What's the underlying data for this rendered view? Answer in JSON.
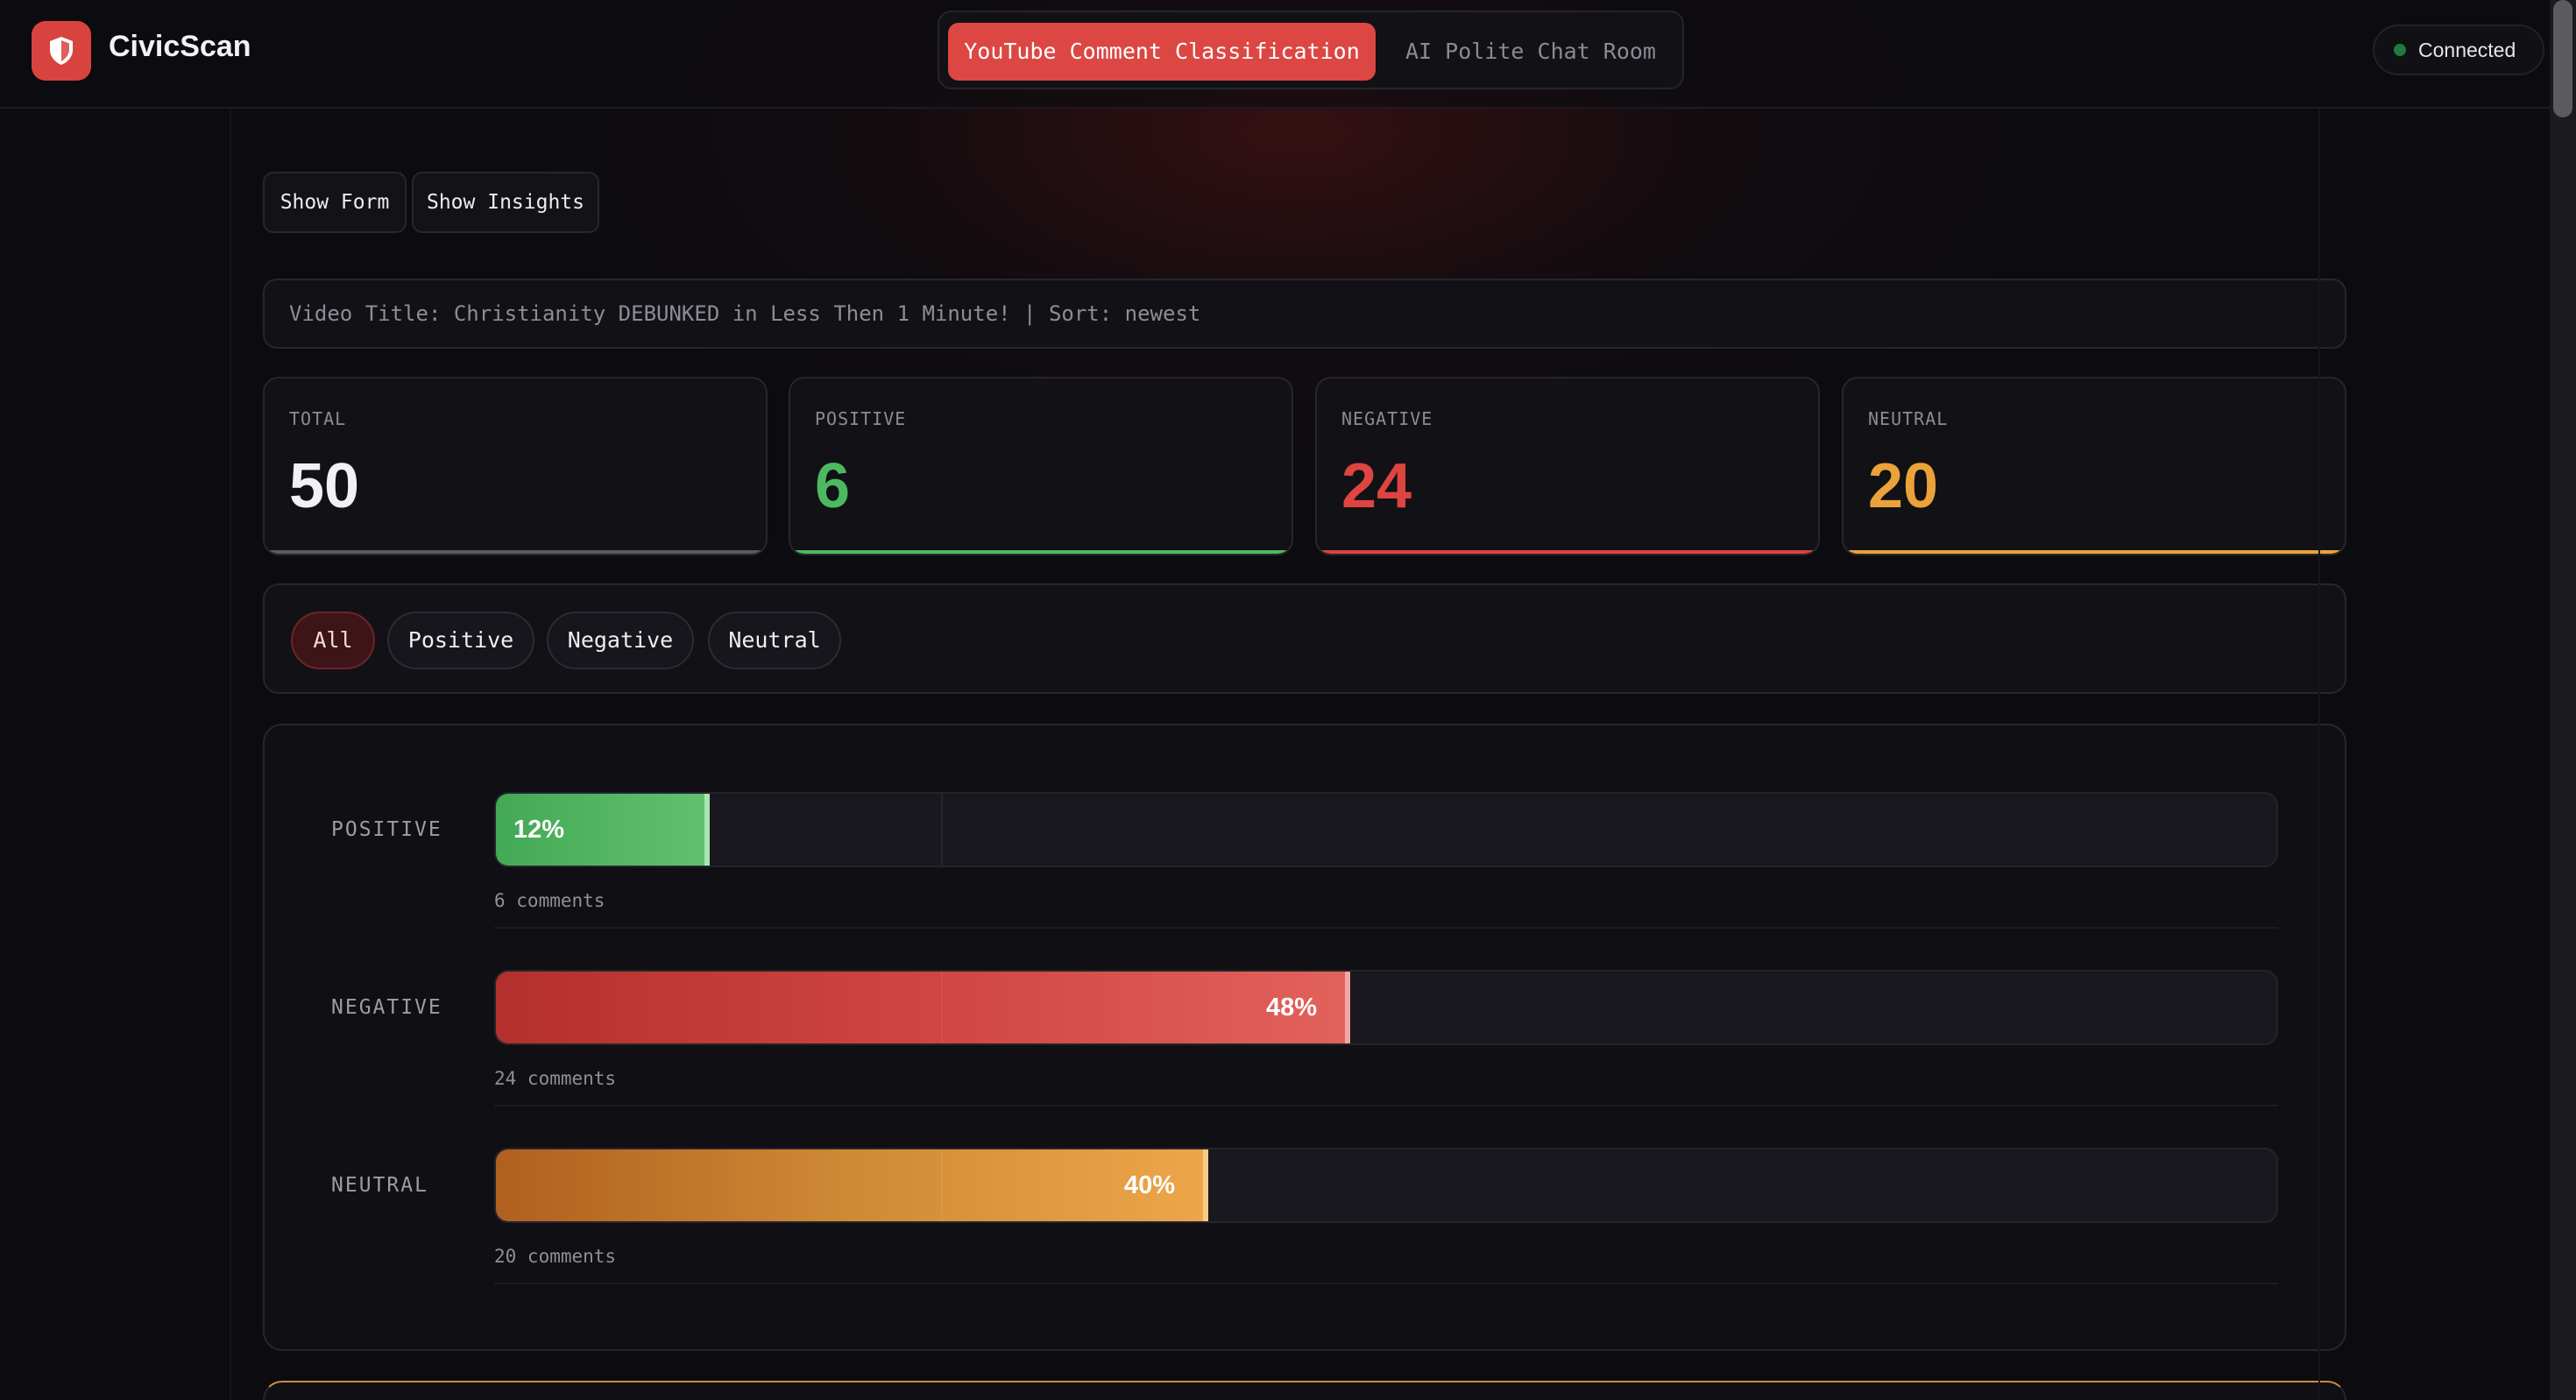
{
  "header": {
    "brand": "CivicScan",
    "tabs": [
      {
        "label": "YouTube Comment Classification",
        "active": true
      },
      {
        "label": "AI Polite Chat Room",
        "active": false
      }
    ],
    "connection_status": "Connected",
    "logo_icon": "shield-icon"
  },
  "toolbar": {
    "show_form_label": "Show Form",
    "show_insights_label": "Show Insights"
  },
  "video_info": "Video Title: Christianity DEBUNKED in Less Then 1 Minute! | Sort: newest",
  "stats": [
    {
      "label": "TOTAL",
      "value": "50",
      "color": "#f1f1f3"
    },
    {
      "label": "POSITIVE",
      "value": "6",
      "color": "#4cb960"
    },
    {
      "label": "NEGATIVE",
      "value": "24",
      "color": "#de4440"
    },
    {
      "label": "NEUTRAL",
      "value": "20",
      "color": "#eba23a"
    }
  ],
  "filters": {
    "items": [
      "All",
      "Positive",
      "Negative",
      "Neutral"
    ],
    "selected": "All"
  },
  "insights": {
    "rows": [
      {
        "label": "POSITIVE",
        "percent_label": "12%",
        "fraction": 0.12,
        "count_label": "6 comments"
      },
      {
        "label": "NEGATIVE",
        "percent_label": "48%",
        "fraction": 0.48,
        "count_label": "24 comments"
      },
      {
        "label": "NEUTRAL",
        "percent_label": "40%",
        "fraction": 0.4,
        "count_label": "20 comments"
      }
    ]
  },
  "colors": {
    "accent": "#dc4743",
    "positive": "#4cb960",
    "negative": "#de4440",
    "neutral": "#eba23a"
  }
}
